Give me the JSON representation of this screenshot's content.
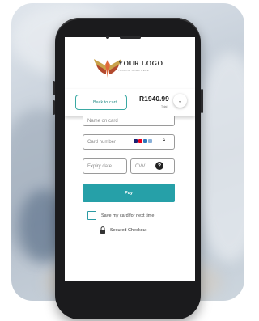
{
  "brand": {
    "logo_text": "YOUR LOGO",
    "tagline": "TAGLINE GOES HERE"
  },
  "header": {
    "back_label": "Back to cart",
    "price": "R1940.99",
    "total_label": "Total"
  },
  "form": {
    "name_placeholder": "Name on card",
    "card_placeholder": "Card number",
    "expiry_placeholder": "Expiry date",
    "cvv_placeholder": "CVV"
  },
  "pay_label": "Pay",
  "save_label": "Save my card for next time",
  "secure_label": "Secured Checkout",
  "colors": {
    "accent": "#26a0a8",
    "accent_border": "#3aa9a3",
    "phone_body": "#1b1b1d"
  },
  "icons": [
    "back-arrow-icon",
    "chevron-down-icon",
    "card-brand-icons",
    "lock-icon",
    "help-icon",
    "padlock-icon"
  ]
}
